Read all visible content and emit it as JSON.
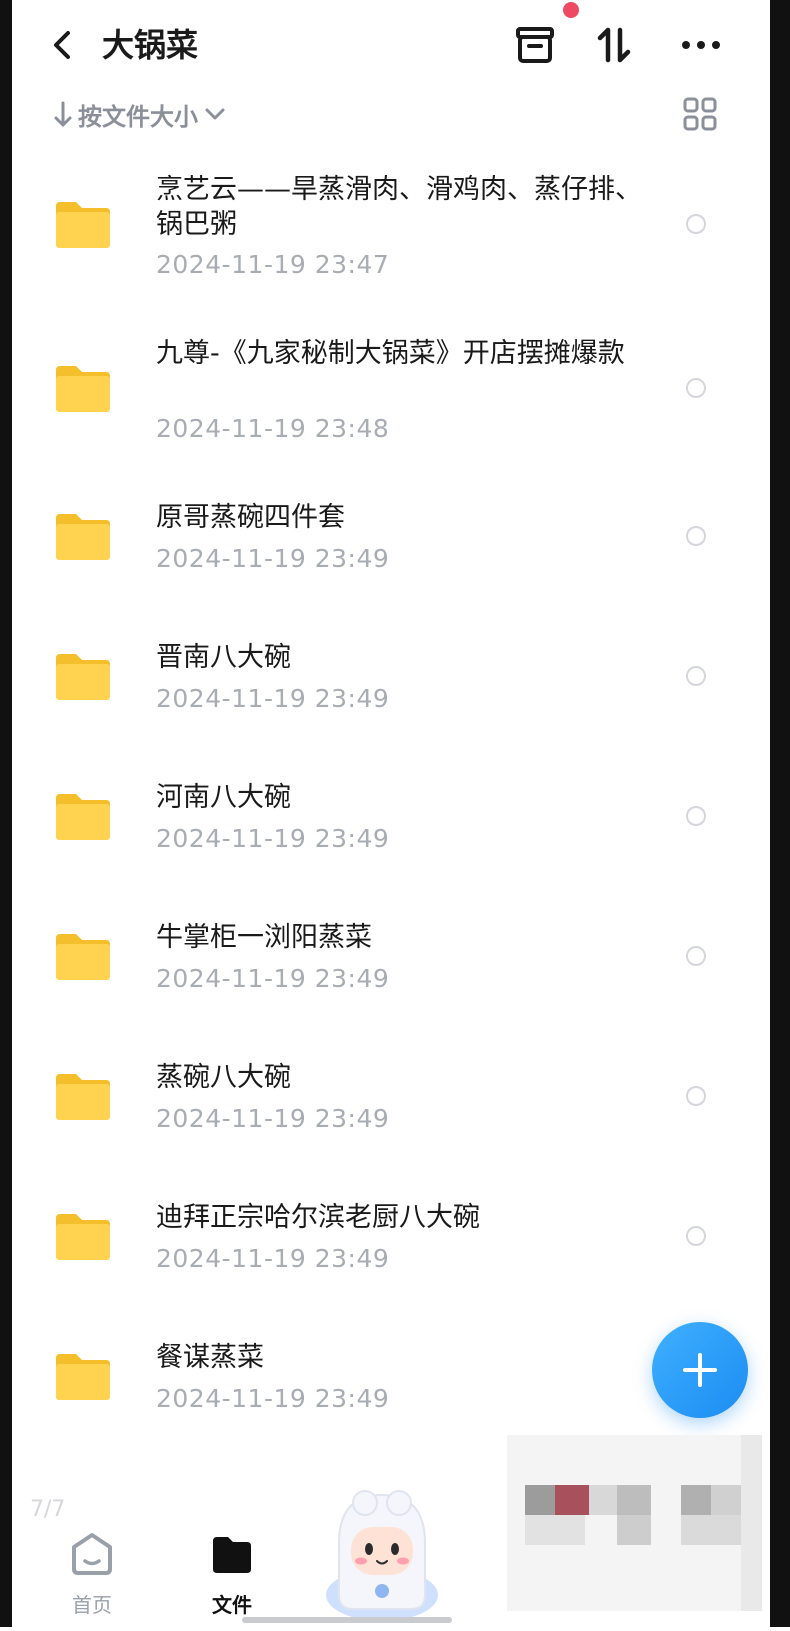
{
  "header": {
    "title": "大锅菜",
    "notification_dot_color": "#f04a63"
  },
  "sortbar": {
    "label": "按文件大小"
  },
  "files": [
    {
      "name": "烹艺云——旱蒸滑肉、滑鸡肉、蒸仔排、锅巴粥",
      "date": "2024-11-19  23:47"
    },
    {
      "name": "九尊-《九家秘制大锅菜》开店摆摊爆款",
      "date": "2024-11-19  23:48"
    },
    {
      "name": "原哥蒸碗四件套",
      "date": "2024-11-19  23:49"
    },
    {
      "name": "晋南八大碗",
      "date": "2024-11-19  23:49"
    },
    {
      "name": "河南八大碗",
      "date": "2024-11-19  23:49"
    },
    {
      "name": "牛掌柜一浏阳蒸菜",
      "date": "2024-11-19  23:49"
    },
    {
      "name": "蒸碗八大碗",
      "date": "2024-11-19  23:49"
    },
    {
      "name": "迪拜正宗哈尔滨老厨八大碗",
      "date": "2024-11-19  23:49"
    },
    {
      "name": "餐谋蒸菜",
      "date": "2024-11-19  23:49"
    }
  ],
  "bottom_nav": {
    "page_indicator": "7/7",
    "home_label": "首页",
    "files_label": "文件"
  },
  "colors": {
    "accent": "#1c8cf2",
    "folder": "#ffd34f",
    "date_text": "#a8acb3"
  }
}
